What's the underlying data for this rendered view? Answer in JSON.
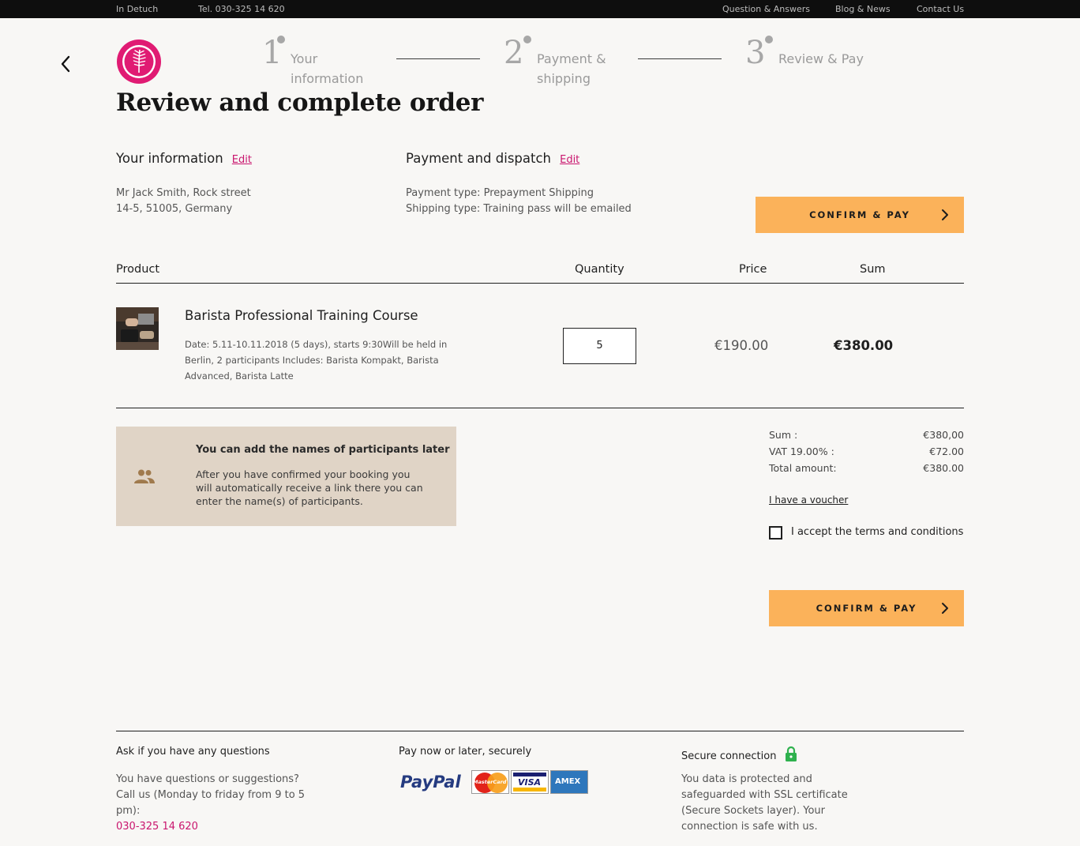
{
  "topbar": {
    "language": "In Detuch",
    "phone": "Tel. 030-325 14 620",
    "links": [
      "Question & Answers",
      "Blog & News",
      "Contact Us"
    ]
  },
  "steps": [
    {
      "number": "1",
      "label": "Your information"
    },
    {
      "number": "2",
      "label": "Payment & shipping"
    },
    {
      "number": "3",
      "label": "Review & Pay"
    }
  ],
  "page_title": "Review and complete order",
  "your_info": {
    "heading": "Your information",
    "edit": "Edit",
    "line1": "Mr Jack Smith, Rock street",
    "line2": "14-5, 51005, Germany"
  },
  "payment": {
    "heading": "Payment and dispatch",
    "edit": "Edit",
    "line1": "Payment type: Prepayment Shipping",
    "line2": "Shipping type: Training pass will be emailed"
  },
  "confirm_label": "CONFIRM & PAY",
  "table": {
    "headers": {
      "product": "Product",
      "quantity": "Quantity",
      "price": "Price",
      "sum": "Sum"
    },
    "item": {
      "name": "Barista Professional Training Course",
      "description": "Date: 5.11-10.11.2018 (5 days), starts 9:30Will be held in Berlin, 2 participants Includes: Barista Kompakt, Barista Advanced, Barista Latte",
      "quantity": "5",
      "price": "€190.00",
      "sum": "€380.00"
    }
  },
  "notice": {
    "icon": "people-icon",
    "title": "You can add the names of participants later",
    "text": "After you have confirmed your booking you will automatically receive a link there you can enter the name(s) of participants."
  },
  "totals": {
    "sum_label": "Sum :",
    "sum_value": "€380,00",
    "vat_label": "VAT 19.00% :",
    "vat_value": "€72.00",
    "total_label": "Total amount:",
    "total_value": "€380.00"
  },
  "voucher": "I have a voucher",
  "terms": "I accept the terms and conditions",
  "footer": {
    "questions": {
      "heading": "Ask if you have any questions",
      "text": "You have questions or suggestions? Call us (Monday to friday from 9 to 5 pm):",
      "phone": "030-325 14 620"
    },
    "pay": {
      "heading": "Pay now or later, securely",
      "paypal": "PayPal",
      "mastercard": "MasterCard",
      "visa": "VISA",
      "amex": "AMEX"
    },
    "secure": {
      "heading": "Secure connection",
      "text": "You data is protected and safeguarded with SSL certificate (Secure Sockets layer). Your connection is safe with us."
    }
  },
  "colors": {
    "accent": "#fbb25a",
    "link": "#c9166e",
    "notice_bg": "#e0d4c6",
    "lock": "#2fb14e"
  }
}
